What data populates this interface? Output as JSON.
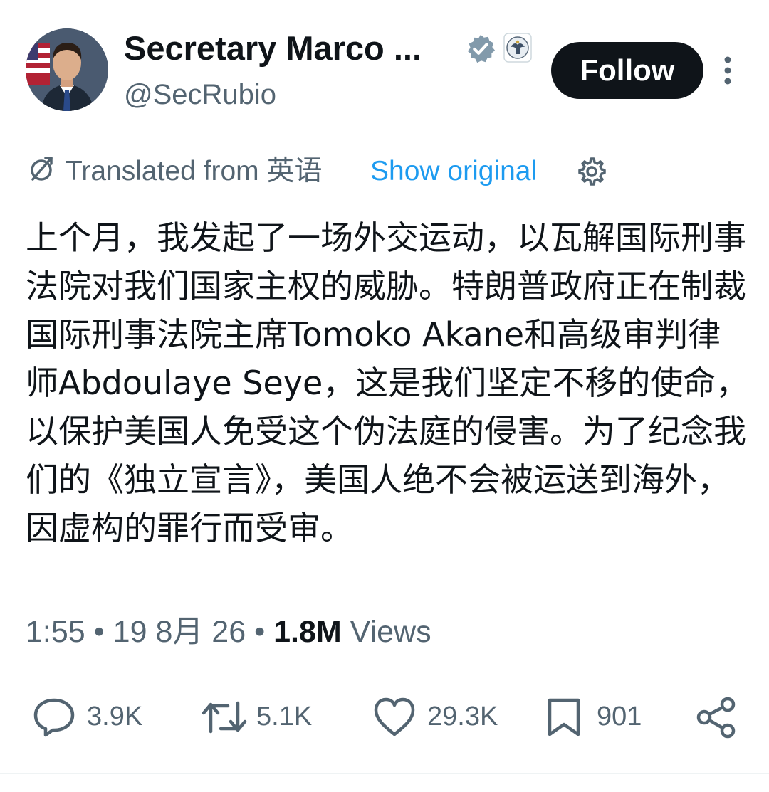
{
  "author": {
    "display_name": "Secretary Marco ...",
    "handle": "@SecRubio",
    "verified_icon": "verified-badge-icon",
    "affiliation_icon": "government-seal-icon"
  },
  "header": {
    "follow_label": "Follow",
    "more_icon": "more-vertical-icon"
  },
  "translation": {
    "label": "Translated from 英语",
    "show_original_label": "Show original"
  },
  "tweet": {
    "text": "上个月，我发起了一场外交运动，以瓦解国际刑事法院对我们国家主权的威胁。特朗普政府正在制裁国际刑事法院主席Tomoko Akane和高级审判律师Abdoulaye Seye，这是我们坚定不移的使命，以保护美国人免受这个伪法庭的侵害。为了纪念我们的《独立宣言》，美国人绝不会被运送到海外，因虚构的罪行而受审。"
  },
  "meta": {
    "time": "1:55",
    "separator": "•",
    "date": "19 8月 26",
    "views_count": "1.8M",
    "views_label": "Views"
  },
  "actions": {
    "replies": "3.9K",
    "reposts": "5.1K",
    "likes": "29.3K",
    "bookmarks": "901"
  },
  "colors": {
    "text_primary": "#0f1419",
    "text_secondary": "#536471",
    "link_blue": "#1d9bf0",
    "verified_gray": "#829aab",
    "follow_bg": "#0f1419",
    "follow_text": "#ffffff"
  }
}
